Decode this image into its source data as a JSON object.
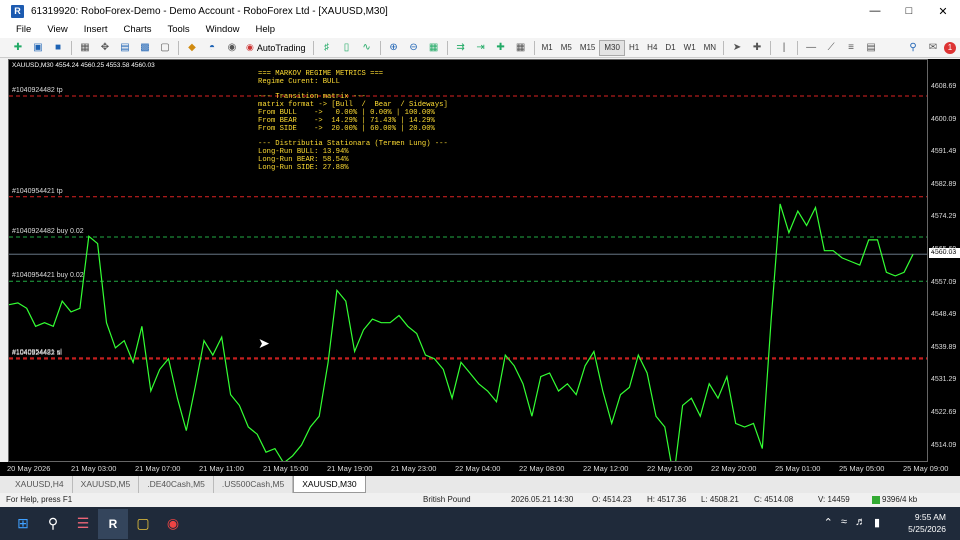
{
  "window": {
    "title": "61319920: RoboForex-Demo - Demo Account - RoboForex Ltd - [XAUUSD,M30]",
    "app_letter": "R"
  },
  "menu": [
    "File",
    "View",
    "Insert",
    "Charts",
    "Tools",
    "Window",
    "Help"
  ],
  "toolbar": {
    "autotrading_label": "AutoTrading",
    "timeframes": [
      "M1",
      "M5",
      "M15",
      "M30",
      "H1",
      "H4",
      "D1",
      "W1",
      "MN"
    ],
    "active_timeframe": "M30"
  },
  "chart": {
    "header": "XAUUSD,M30  4554.24 4560.25 4553.58 4560.03",
    "line_color": "#33ff33",
    "order_lines": [
      {
        "label": "#1040924482 tp",
        "price": 4604.0,
        "color": "#d22"
      },
      {
        "label": "#1040954421 tp",
        "price": 4576.0,
        "color": "#d22"
      },
      {
        "label": "#1040924482 buy 0.02",
        "price": 4564.8,
        "color": "#2a4"
      },
      {
        "label": "#1040954421 buy 0.02",
        "price": 4552.5,
        "color": "#2a4"
      },
      {
        "label": "#1040954421 sl",
        "price": 4531.2,
        "color": "#d22"
      },
      {
        "label": "#1040924482 sl",
        "price": 4530.9,
        "color": "#d22"
      }
    ],
    "current_price": 4560.03,
    "current_price_label": "4560.03",
    "yticks": [
      "4608.69",
      "4600.09",
      "4591.49",
      "4582.89",
      "4574.29",
      "4565.69",
      "4557.09",
      "4548.49",
      "4539.89",
      "4531.29",
      "4522.69",
      "4514.09"
    ],
    "xticks": [
      "20 May 2026",
      "21 May 03:00",
      "21 May 07:00",
      "21 May 11:00",
      "21 May 15:00",
      "21 May 19:00",
      "21 May 23:00",
      "22 May 04:00",
      "22 May 08:00",
      "22 May 12:00",
      "22 May 16:00",
      "22 May 20:00",
      "25 May 01:00",
      "25 May 05:00",
      "25 May 09:00"
    ],
    "prices": [
      4546,
      4546.5,
      4545,
      4540,
      4541,
      4540,
      4547,
      4544,
      4545,
      4565,
      4563,
      4541,
      4534,
      4536,
      4530,
      4540,
      4522,
      4528,
      4531,
      4520,
      4511,
      4523,
      4536,
      4532,
      4537,
      4521,
      4518,
      4512,
      4510,
      4505,
      4506,
      4502,
      4504,
      4507,
      4512,
      4515,
      4530,
      4550,
      4547,
      4533,
      4539,
      4542,
      4541,
      4541,
      4543,
      4540,
      4538,
      4532,
      4531,
      4528,
      4520,
      4530,
      4527,
      4524,
      4522,
      4519,
      4532,
      4529,
      4524,
      4515,
      4526,
      4527,
      4522,
      4524,
      4521,
      4529,
      4533,
      4522,
      4513,
      4521,
      4523,
      4532,
      4527,
      4515,
      4512,
      4498,
      4518,
      4520,
      4515,
      4524,
      4520,
      4526,
      4513,
      4512,
      4513,
      4506,
      4542,
      4574,
      4566,
      4572,
      4568,
      4573,
      4561,
      4561,
      4559,
      4558,
      4557,
      4564,
      4564,
      4555,
      4554,
      4555,
      4560
    ]
  },
  "info_panel": [
    "=== MARKOV REGIME METRICS ===",
    "Regime Curent: BULL",
    "",
    "--- Transition matrix ---",
    "matrix format -> [Bull  /  Bear  / Sideways]",
    "From BULL    ->   0.00% | 0.00% | 100.00%",
    "From BEAR    ->  14.29% | 71.43% | 14.29%",
    "From SIDE    ->  20.00% | 60.00% | 20.00%",
    "",
    "--- Distributia Stationara (Termen Lung) ---",
    "Long-Run BULL: 13.94%",
    "Long-Run BEAR: 58.54%",
    "Long-Run SIDE: 27.88%"
  ],
  "tabs": [
    "XAUUSD,H4",
    "XAUUSD,M5",
    ".DE40Cash,M5",
    ".US500Cash,M5",
    "XAUUSD,M30"
  ],
  "active_tab": "XAUUSD,M30",
  "status": {
    "help": "For Help, press F1",
    "profile": "British Pound",
    "datetime": "2026.05.21 14:30",
    "open": "O: 4514.23",
    "high": "H: 4517.36",
    "low": "L: 4508.21",
    "close": "C: 4514.08",
    "volume": "V: 14459",
    "traffic": "9396/4 kb"
  },
  "taskbar": {
    "time": "9:55 AM",
    "date": "5/25/2026"
  }
}
